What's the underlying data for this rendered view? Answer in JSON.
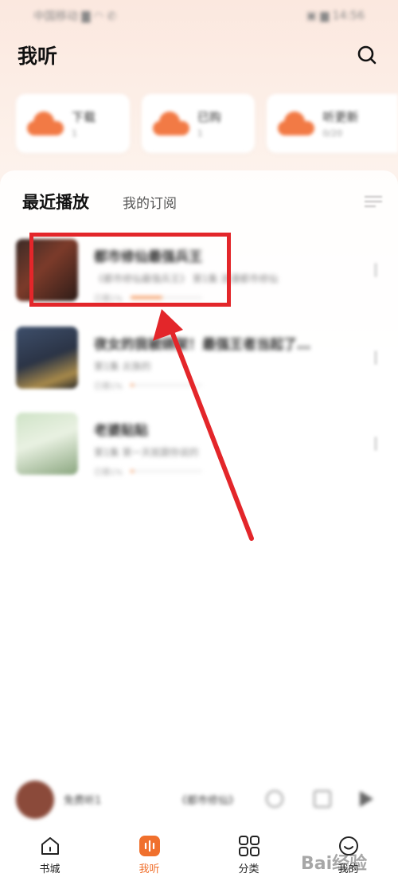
{
  "status_bar": {
    "left": "中国移动 ▇ ◠ ✆",
    "right": "▣ ▆ 14:56"
  },
  "header": {
    "title": "我听"
  },
  "quick_cards": [
    {
      "label": "下载",
      "count": "1"
    },
    {
      "label": "已购",
      "count": "1"
    },
    {
      "label": "听更新",
      "count": "0/20"
    }
  ],
  "tabs": {
    "recent": "最近播放",
    "subscribed": "我的订阅"
  },
  "recent_items": [
    {
      "title": "都市修仙最强兵王",
      "subtitle": "《都市修仙最强兵王》 第1集 浪漫都市修仙",
      "time": "已播1%",
      "progress": 0.45
    },
    {
      "title": "夜女的我被绑架！最强王者当起了…",
      "subtitle": "第1集 炎族的",
      "time": "已播1%",
      "progress": 0.05
    },
    {
      "title": "老婆贴贴",
      "subtitle": "第1集 第一天就跟你说的",
      "time": "已播1%",
      "progress": 0.05
    }
  ],
  "mini_player": {
    "title": "免费听1",
    "subtitle": "《都市修仙》"
  },
  "bottom_nav": [
    {
      "label": "书城",
      "icon": "home-icon"
    },
    {
      "label": "我听",
      "icon": "listen-icon"
    },
    {
      "label": "分类",
      "icon": "grid-icon"
    },
    {
      "label": "我的",
      "icon": "profile-icon"
    }
  ],
  "watermark": "Bai经验",
  "colors": {
    "accent": "#f0702d",
    "highlight": "#e3262a"
  }
}
